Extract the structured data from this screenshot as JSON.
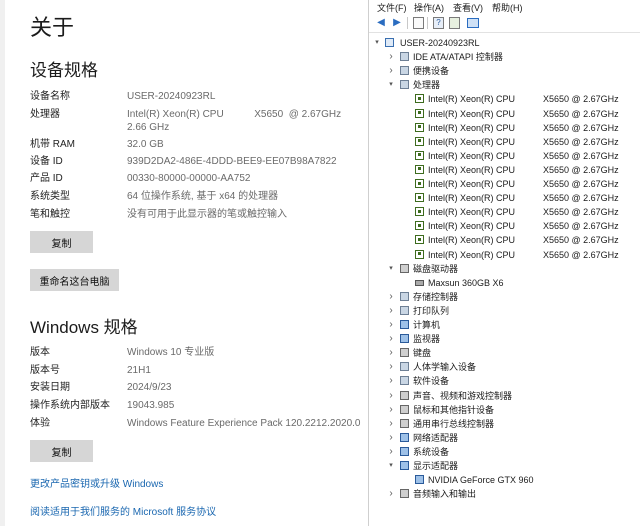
{
  "about": {
    "page_title": "关于",
    "device_specs": {
      "title": "设备规格",
      "rows": [
        {
          "key": "设备名称",
          "value": "USER-20240923RL"
        },
        {
          "key": "处理器",
          "value": "Intel(R) Xeon(R) CPU           X5650  @ 2.67GHz\n2.66 GHz"
        },
        {
          "key": "机带 RAM",
          "value": "32.0 GB"
        },
        {
          "key": "设备 ID",
          "value": "939D2DA2-486E-4DDD-BEE9-EE07B98A7822"
        },
        {
          "key": "产品 ID",
          "value": "00330-80000-00000-AA752"
        },
        {
          "key": "系统类型",
          "value": "64 位操作系统, 基于 x64 的处理器"
        },
        {
          "key": "笔和触控",
          "value": "没有可用于此显示器的笔或触控输入"
        }
      ],
      "copy_label": "复制",
      "rename_label": "重命名这台电脑"
    },
    "windows_specs": {
      "title": "Windows 规格",
      "rows": [
        {
          "key": "版本",
          "value": "Windows 10 专业版"
        },
        {
          "key": "版本号",
          "value": "21H1"
        },
        {
          "key": "安装日期",
          "value": "2024/9/23"
        },
        {
          "key": "操作系统内部版本",
          "value": "19043.985"
        },
        {
          "key": "体验",
          "value": "Windows Feature Experience Pack 120.2212.2020.0"
        }
      ],
      "copy_label": "复制"
    },
    "links": {
      "change_key": "更改产品密钥或升级 Windows",
      "service_agreement": "阅读适用于我们服务的 Microsoft 服务协议"
    }
  },
  "device_manager": {
    "menu": [
      "文件(F)",
      "操作(A)",
      "查看(V)",
      "帮助(H)"
    ],
    "toolbar_icons": [
      "back-arrow-icon",
      "forward-arrow-icon",
      "properties-icon",
      "help-icon",
      "update-driver-icon",
      "monitor-icon"
    ],
    "root": "USER-20240923RL",
    "categories": [
      {
        "label": "IDE ATA/ATAPI 控制器",
        "expanded": false,
        "icon": "ide-controller-icon"
      },
      {
        "label": "便携设备",
        "expanded": false,
        "icon": "portable-device-icon"
      },
      {
        "label": "处理器",
        "expanded": true,
        "icon": "processor-icon",
        "children": [
          {
            "name": "Intel(R) Xeon(R) CPU",
            "model": "X5650  @ 2.67GHz"
          },
          {
            "name": "Intel(R) Xeon(R) CPU",
            "model": "X5650  @ 2.67GHz"
          },
          {
            "name": "Intel(R) Xeon(R) CPU",
            "model": "X5650  @ 2.67GHz"
          },
          {
            "name": "Intel(R) Xeon(R) CPU",
            "model": "X5650  @ 2.67GHz"
          },
          {
            "name": "Intel(R) Xeon(R) CPU",
            "model": "X5650  @ 2.67GHz"
          },
          {
            "name": "Intel(R) Xeon(R) CPU",
            "model": "X5650  @ 2.67GHz"
          },
          {
            "name": "Intel(R) Xeon(R) CPU",
            "model": "X5650  @ 2.67GHz"
          },
          {
            "name": "Intel(R) Xeon(R) CPU",
            "model": "X5650  @ 2.67GHz"
          },
          {
            "name": "Intel(R) Xeon(R) CPU",
            "model": "X5650  @ 2.67GHz"
          },
          {
            "name": "Intel(R) Xeon(R) CPU",
            "model": "X5650  @ 2.67GHz"
          },
          {
            "name": "Intel(R) Xeon(R) CPU",
            "model": "X5650  @ 2.67GHz"
          },
          {
            "name": "Intel(R) Xeon(R) CPU",
            "model": "X5650  @ 2.67GHz"
          }
        ]
      },
      {
        "label": "磁盘驱动器",
        "expanded": true,
        "icon": "disk-drive-icon",
        "children": [
          {
            "name": "Maxsun  360GB X6",
            "model": ""
          }
        ]
      },
      {
        "label": "存储控制器",
        "expanded": false,
        "icon": "storage-controller-icon"
      },
      {
        "label": "打印队列",
        "expanded": false,
        "icon": "print-queue-icon"
      },
      {
        "label": "计算机",
        "expanded": false,
        "icon": "computer-icon"
      },
      {
        "label": "监视器",
        "expanded": false,
        "icon": "monitor-icon"
      },
      {
        "label": "键盘",
        "expanded": false,
        "icon": "keyboard-icon"
      },
      {
        "label": "人体学输入设备",
        "expanded": false,
        "icon": "hid-icon"
      },
      {
        "label": "软件设备",
        "expanded": false,
        "icon": "software-device-icon"
      },
      {
        "label": "声音、视频和游戏控制器",
        "expanded": false,
        "icon": "sound-icon"
      },
      {
        "label": "鼠标和其他指针设备",
        "expanded": false,
        "icon": "mouse-icon"
      },
      {
        "label": "通用串行总线控制器",
        "expanded": false,
        "icon": "usb-icon"
      },
      {
        "label": "网络适配器",
        "expanded": false,
        "icon": "network-adapter-icon"
      },
      {
        "label": "系统设备",
        "expanded": false,
        "icon": "system-device-icon"
      },
      {
        "label": "显示适配器",
        "expanded": true,
        "icon": "display-adapter-icon",
        "children": [
          {
            "name": "NVIDIA GeForce GTX 960",
            "model": ""
          }
        ]
      },
      {
        "label": "音频输入和输出",
        "expanded": false,
        "icon": "audio-io-icon"
      }
    ]
  }
}
